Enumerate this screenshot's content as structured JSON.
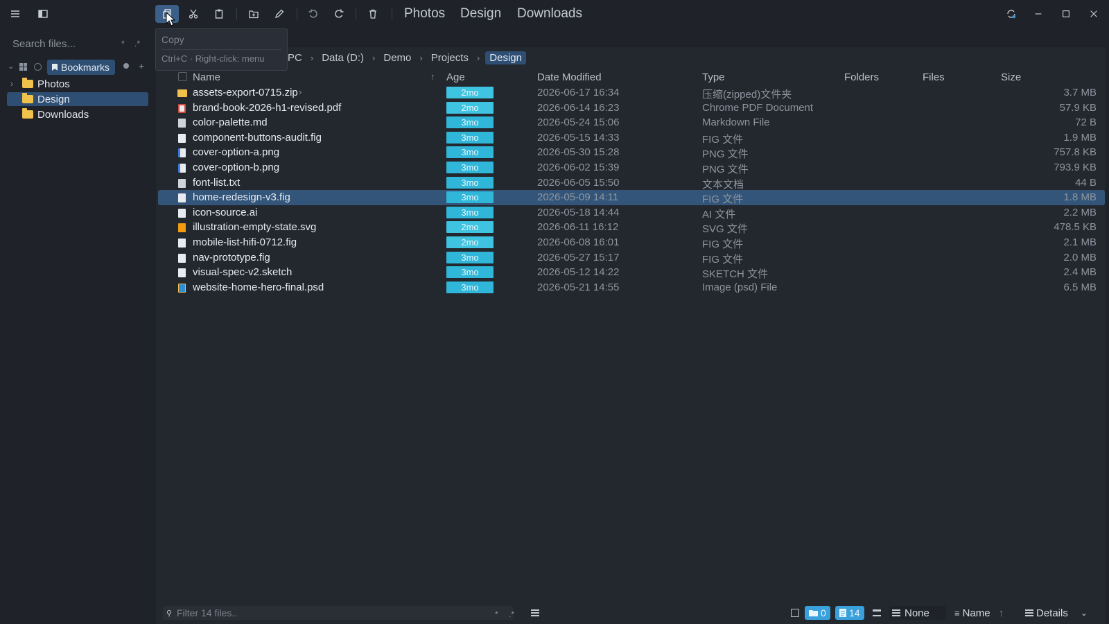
{
  "toolbar": {
    "tabs": [
      "Photos",
      "Design",
      "Downloads"
    ]
  },
  "tooltip": {
    "title": "Copy",
    "hint": "Ctrl+C · Right-click: menu"
  },
  "sidebar": {
    "search_placeholder": "Search files...",
    "search_star": "*",
    "search_regex": ".*",
    "bookmarks_label": "Bookmarks",
    "tree": [
      {
        "label": "Photos",
        "selected": false
      },
      {
        "label": "Design",
        "selected": true
      },
      {
        "label": "Downloads",
        "selected": false
      }
    ]
  },
  "breadcrumb": [
    "PC",
    "Data (D:)",
    "Demo",
    "Projects",
    "Design"
  ],
  "columns": {
    "name": "Name",
    "age": "Age",
    "date": "Date Modified",
    "type": "Type",
    "folders": "Folders",
    "files": "Files",
    "size": "Size"
  },
  "files": [
    {
      "name": "assets-export-0715.zip",
      "age": "2mo",
      "date": "2026-06-17 16:34",
      "type": "压缩(zipped)文件夹",
      "size": "3.7 MB",
      "icon": "zip-icon"
    },
    {
      "name": "brand-book-2026-h1-revised.pdf",
      "age": "2mo",
      "date": "2026-06-14 16:23",
      "type": "Chrome PDF Document",
      "size": "57.9 KB",
      "icon": "pdf-icon"
    },
    {
      "name": "color-palette.md",
      "age": "3mo",
      "date": "2026-05-24 15:06",
      "type": "Markdown File",
      "size": "72 B",
      "icon": "markdown-icon"
    },
    {
      "name": "component-buttons-audit.fig",
      "age": "3mo",
      "date": "2026-05-15 14:33",
      "type": "FIG 文件",
      "size": "1.9 MB",
      "icon": "file-icon"
    },
    {
      "name": "cover-option-a.png",
      "age": "3mo",
      "date": "2026-05-30 15:28",
      "type": "PNG 文件",
      "size": "757.8 KB",
      "icon": "image-icon"
    },
    {
      "name": "cover-option-b.png",
      "age": "3mo",
      "date": "2026-06-02 15:39",
      "type": "PNG 文件",
      "size": "793.9 KB",
      "icon": "image-icon"
    },
    {
      "name": "font-list.txt",
      "age": "3mo",
      "date": "2026-06-05 15:50",
      "type": "文本文档",
      "size": "44 B",
      "icon": "text-icon"
    },
    {
      "name": "home-redesign-v3.fig",
      "age": "3mo",
      "date": "2026-05-09 14:11",
      "type": "FIG 文件",
      "size": "1.8 MB",
      "icon": "file-icon",
      "selected": true
    },
    {
      "name": "icon-source.ai",
      "age": "3mo",
      "date": "2026-05-18 14:44",
      "type": "AI 文件",
      "size": "2.2 MB",
      "icon": "file-icon"
    },
    {
      "name": "illustration-empty-state.svg",
      "age": "2mo",
      "date": "2026-06-11 16:12",
      "type": "SVG 文件",
      "size": "478.5 KB",
      "icon": "svg-icon"
    },
    {
      "name": "mobile-list-hifi-0712.fig",
      "age": "2mo",
      "date": "2026-06-08 16:01",
      "type": "FIG 文件",
      "size": "2.1 MB",
      "icon": "file-icon"
    },
    {
      "name": "nav-prototype.fig",
      "age": "3mo",
      "date": "2026-05-27 15:17",
      "type": "FIG 文件",
      "size": "2.0 MB",
      "icon": "file-icon"
    },
    {
      "name": "visual-spec-v2.sketch",
      "age": "3mo",
      "date": "2026-05-12 14:22",
      "type": "SKETCH 文件",
      "size": "2.4 MB",
      "icon": "file-icon"
    },
    {
      "name": "website-home-hero-final.psd",
      "age": "3mo",
      "date": "2026-05-21 14:55",
      "type": "Image (psd) File",
      "size": "6.5 MB",
      "icon": "psd-icon"
    }
  ],
  "bottom": {
    "filter_placeholder": "Filter 14 files..",
    "filter_star": "*",
    "filter_regex": ".*",
    "folder_count": "0",
    "file_count": "14",
    "group_label": "None",
    "sort_label": "Name",
    "view_label": "Details"
  },
  "colors": {
    "accent": "#2e4f73",
    "age_bar": "#2fb6d8",
    "folder": "#f0c14b"
  }
}
